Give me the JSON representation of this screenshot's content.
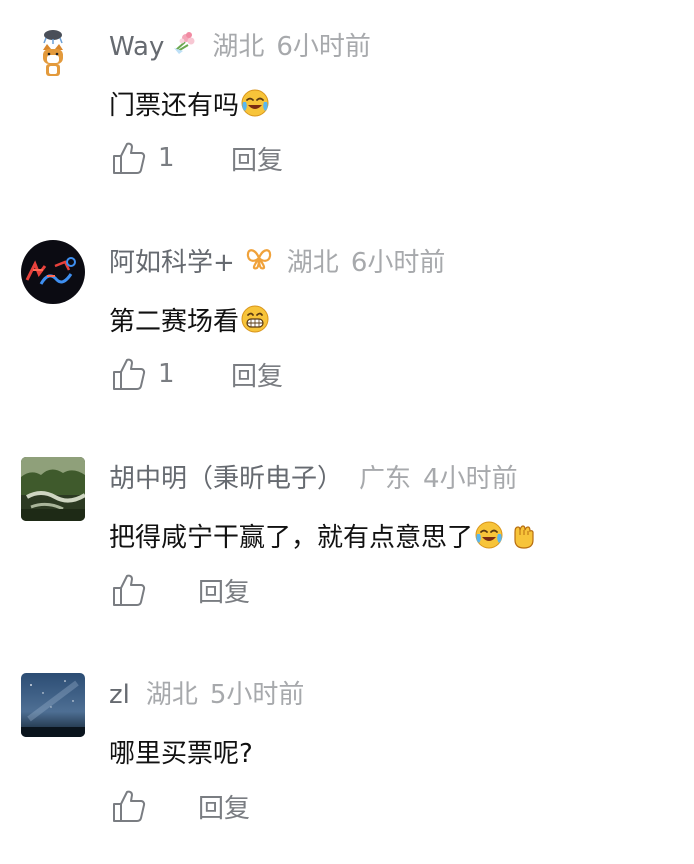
{
  "comments": [
    {
      "username": "Way",
      "location": "湖北",
      "time": "6小时前",
      "text": "门票还有吗",
      "likes": "1",
      "reply_label": "回复",
      "avatar_icon": "shiba-dog-avatar",
      "badge_icon": "bouquet-icon",
      "emoji_icons": [
        "laughing-crying-emoji"
      ]
    },
    {
      "username": "阿如科学+",
      "location": "湖北",
      "time": "6小时前",
      "text": "第二赛场看",
      "likes": "1",
      "reply_label": "回复",
      "avatar_icon": "neon-logo-avatar",
      "badge_icon": "butterfly-vip-icon",
      "emoji_icons": [
        "grinning-emoji"
      ]
    },
    {
      "username": "胡中明（秉昕电子）",
      "location": "广东",
      "time": "4小时前",
      "text": "把得咸宁干赢了，就有点意思了",
      "likes": "",
      "reply_label": "回复",
      "avatar_icon": "forest-photo-avatar",
      "emoji_icons": [
        "laughing-crying-emoji",
        "raised-fist-emoji"
      ]
    },
    {
      "username": "zl",
      "location": "湖北",
      "time": "5小时前",
      "text": "哪里买票呢?",
      "likes": "",
      "reply_label": "回复",
      "avatar_icon": "starry-sky-avatar",
      "emoji_icons": []
    }
  ]
}
